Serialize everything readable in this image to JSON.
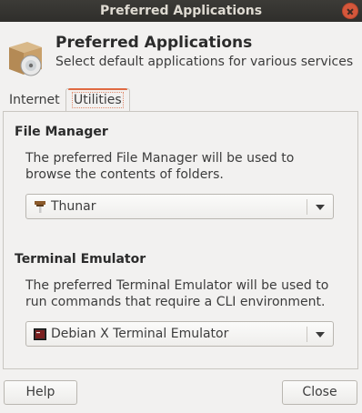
{
  "window": {
    "title": "Preferred Applications"
  },
  "header": {
    "title": "Preferred Applications",
    "subtitle": "Select default applications for various services"
  },
  "tabs": [
    {
      "label": "Internet",
      "selected": false
    },
    {
      "label": "Utilities",
      "selected": true
    }
  ],
  "file_manager": {
    "title": "File Manager",
    "description_line1": "The preferred File Manager will be used to",
    "description_line2": "browse the contents of folders.",
    "selected": "Thunar",
    "icon": "thunar-icon"
  },
  "terminal": {
    "title": "Terminal Emulator",
    "description_line1": "The preferred Terminal Emulator will be used to",
    "description_line2": "run commands that require a CLI environment.",
    "selected": "Debian X Terminal Emulator",
    "icon": "terminal-icon"
  },
  "buttons": {
    "help": "Help",
    "close": "Close"
  },
  "colors": {
    "titlebar": "#3c3b37",
    "accent": "#e06a42",
    "close": "#d5573b"
  }
}
